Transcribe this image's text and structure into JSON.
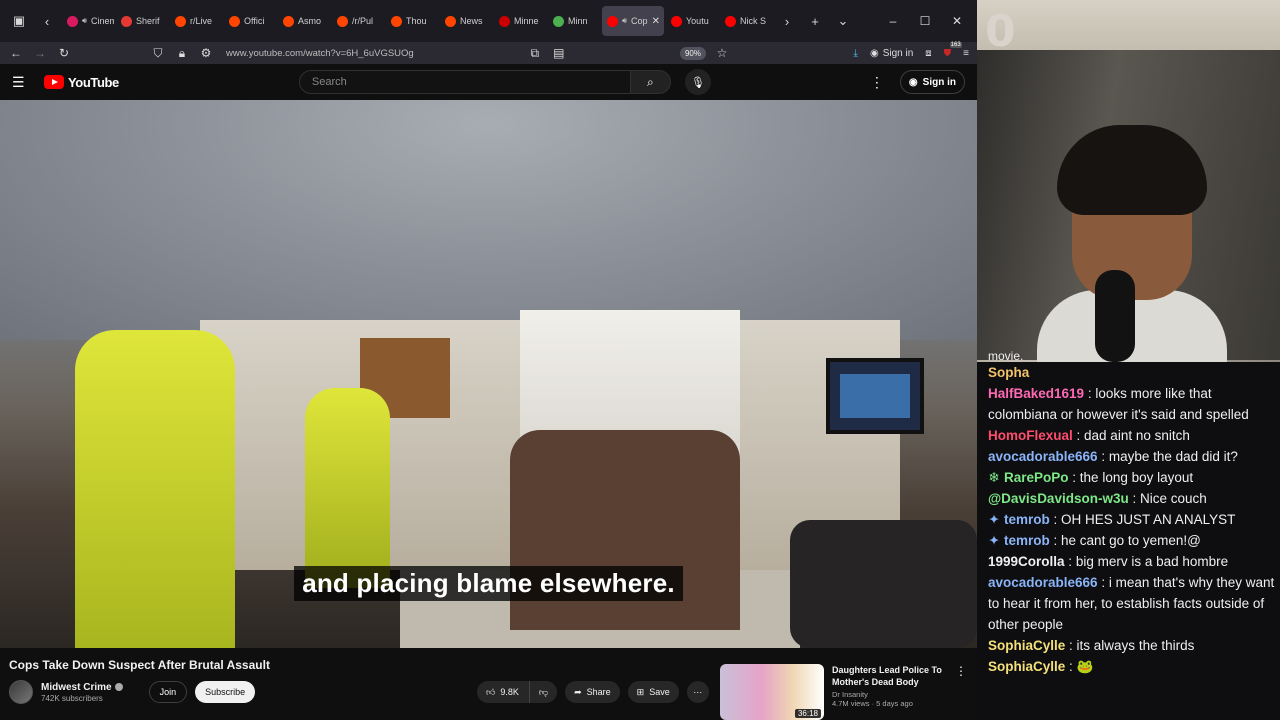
{
  "browser": {
    "tabs": [
      {
        "label": "Cinem",
        "favicon_color": "#d81b60",
        "audio": true
      },
      {
        "label": "Sherif",
        "favicon_color": "#e53935",
        "audio": false
      },
      {
        "label": "r/Live",
        "favicon_color": "#ff4500",
        "audio": false
      },
      {
        "label": "Offici",
        "favicon_color": "#ff4500",
        "audio": false
      },
      {
        "label": "Asmo",
        "favicon_color": "#ff4500",
        "audio": false
      },
      {
        "label": "/r/Pul",
        "favicon_color": "#ff4500",
        "audio": false
      },
      {
        "label": "Thou",
        "favicon_color": "#ff4500",
        "audio": false
      },
      {
        "label": "News",
        "favicon_color": "#ff4500",
        "audio": false
      },
      {
        "label": "Minne",
        "favicon_color": "#cc0000",
        "audio": false
      },
      {
        "label": "Minn",
        "favicon_color": "#4caf50",
        "audio": false
      },
      {
        "label": "Cop",
        "favicon_color": "#ff0000",
        "audio": true,
        "active": true
      },
      {
        "label": "Youtu",
        "favicon_color": "#ff0000",
        "audio": false
      },
      {
        "label": "Nick S",
        "favicon_color": "#ff0000",
        "audio": false
      }
    ],
    "url": "www.youtube.com/watch?v=6H_6uVGSUOg",
    "zoom": "90%",
    "sign_in": "Sign in",
    "notification_count": "163"
  },
  "youtube": {
    "logo_text": "YouTube",
    "search_placeholder": "Search",
    "sign_in": "Sign in",
    "subtitle": "and placing blame elsewhere.",
    "video_title": "Cops Take Down Suspect After Brutal Assault",
    "channel_name": "Midwest Crime",
    "channel_subs": "742K subscribers",
    "join_label": "Join",
    "subscribe_label": "Subscribe",
    "likes": "9.8K",
    "share_label": "Share",
    "save_label": "Save",
    "recommended": {
      "title": "Daughters Lead Police To Mother's Dead Body",
      "channel": "Dr Insanity",
      "meta": "4.7M views · 5 days ago",
      "duration": "36:18"
    }
  },
  "stream": {
    "overlay_number": "0",
    "chat_top_fragment": "movie.",
    "chat": [
      {
        "user": "Sopha",
        "text": "",
        "color": "#f3c36b",
        "badge": ""
      },
      {
        "user": "HalfBaked1619",
        "text": "looks more like that colombiana or however it's said and spelled",
        "color": "#ff69b4",
        "badge": ""
      },
      {
        "user": "HomoFlexual",
        "text": "dad aint no snitch",
        "color": "#ff4d6d",
        "badge": ""
      },
      {
        "user": "avocadorable666",
        "text": "maybe the dad did it?",
        "color": "#8ab4f8",
        "badge": ""
      },
      {
        "user": "RarePoPo",
        "text": "the long boy layout",
        "color": "#7ee787",
        "badge": "❄"
      },
      {
        "user": "@DavisDavidson-w3u",
        "text": "Nice couch",
        "color": "#7ee787",
        "badge": ""
      },
      {
        "user": "temrob",
        "text": "OH HES JUST AN ANALYST",
        "color": "#8ab4f8",
        "badge": "✦"
      },
      {
        "user": "temrob",
        "text": "he cant go to yemen!@",
        "color": "#8ab4f8",
        "badge": "✦"
      },
      {
        "user": "1999Corolla",
        "text": "big merv is a bad hombre",
        "color": "#efeff1",
        "badge": ""
      },
      {
        "user": "avocadorable666",
        "text": "i mean that's why they want to hear it from her, to establish facts outside of other people",
        "color": "#8ab4f8",
        "badge": ""
      },
      {
        "user": "SophiaCylle",
        "text": "its always the thirds",
        "color": "#f3e07a",
        "badge": ""
      },
      {
        "user": "SophiaCylle",
        "text": "🐸",
        "color": "#f3e07a",
        "badge": ""
      }
    ]
  }
}
